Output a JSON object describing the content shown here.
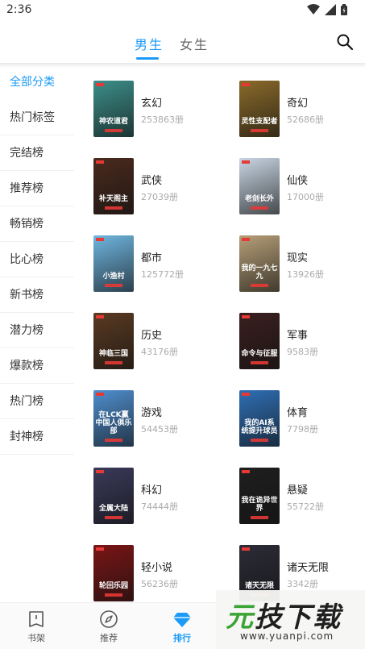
{
  "status_bar": {
    "time": "2:36"
  },
  "top_nav": {
    "tabs": [
      "男生",
      "女生"
    ],
    "active_tab": "男生"
  },
  "sidebar": {
    "items": [
      "全部分类",
      "热门标签",
      "完结榜",
      "推荐榜",
      "畅销榜",
      "比心榜",
      "新书榜",
      "潜力榜",
      "爆款榜",
      "热门榜",
      "封神榜"
    ],
    "active": "全部分类"
  },
  "categories": [
    {
      "name": "玄幻",
      "count": "253863册",
      "cover_title": "神农道君"
    },
    {
      "name": "奇幻",
      "count": "52686册",
      "cover_title": "灵性支配者"
    },
    {
      "name": "武侠",
      "count": "27039册",
      "cover_title": "补天阁主"
    },
    {
      "name": "仙侠",
      "count": "17000册",
      "cover_title": "老剑长外"
    },
    {
      "name": "都市",
      "count": "125772册",
      "cover_title": "小渔村"
    },
    {
      "name": "现实",
      "count": "13926册",
      "cover_title": "我的一九七九"
    },
    {
      "name": "历史",
      "count": "43176册",
      "cover_title": "神临三国"
    },
    {
      "name": "军事",
      "count": "9583册",
      "cover_title": "命令与征服"
    },
    {
      "name": "游戏",
      "count": "54453册",
      "cover_title": "在LCK赢中国人俱乐部"
    },
    {
      "name": "体育",
      "count": "7798册",
      "cover_title": "我的AI系统提升球员"
    },
    {
      "name": "科幻",
      "count": "74444册",
      "cover_title": "全属大陆"
    },
    {
      "name": "悬疑",
      "count": "55722册",
      "cover_title": "我在诡异世界"
    },
    {
      "name": "轻小说",
      "count": "56236册",
      "cover_title": "轮回乐园"
    },
    {
      "name": "诸天无限",
      "count": "3342册",
      "cover_title": "诸天无限"
    }
  ],
  "cover_colors": [
    "#3c8f8a",
    "#8a6a2a",
    "#4a2a1e",
    "#c9d6e4",
    "#6fb6e0",
    "#b69f78",
    "#5a3a22",
    "#3a1f1f",
    "#4f8fcf",
    "#2f6fb5",
    "#3a3a5a",
    "#1f1f1f",
    "#7a1515",
    "#2c2c38"
  ],
  "bottom_nav": {
    "items": [
      {
        "label": "书架",
        "icon": "bookshelf-icon"
      },
      {
        "label": "推荐",
        "icon": "compass-icon"
      },
      {
        "label": "排行",
        "icon": "diamond-icon"
      }
    ],
    "active": "排行"
  },
  "watermark": {
    "main_left": "元",
    "main_rest": "技下载",
    "url": "www.yuanpi.com"
  },
  "accent_color": "#1b9af7"
}
